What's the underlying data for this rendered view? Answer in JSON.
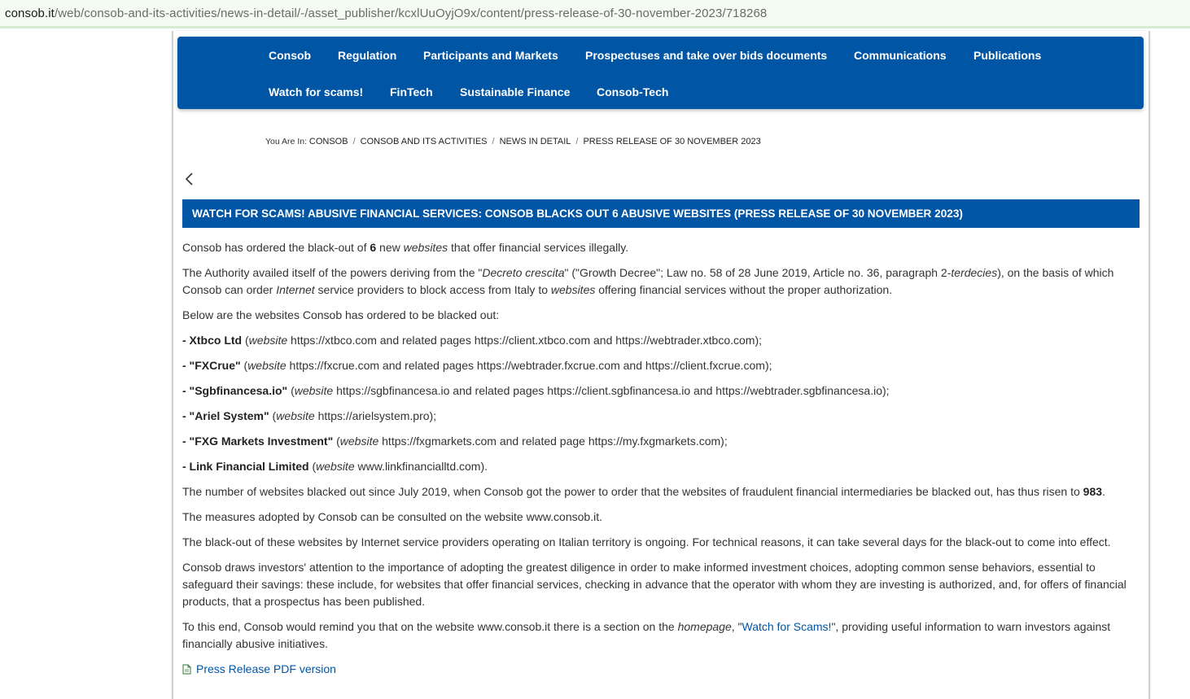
{
  "browser": {
    "url_host": "consob.it",
    "url_path": "/web/consob-and-its-activities/news-in-detail/-/asset_publisher/kcxlUuOyjO9x/content/press-release-of-30-november-2023/718268"
  },
  "nav": {
    "row1": [
      "Consob",
      "Regulation",
      "Participants and Markets",
      "Prospectuses and take over bids documents",
      "Communications",
      "Publications"
    ],
    "row2": [
      "Watch for scams!",
      "FinTech",
      "Sustainable Finance",
      "Consob-Tech"
    ]
  },
  "breadcrumb": {
    "prefix": "You Are In: ",
    "items": [
      "CONSOB",
      "CONSOB AND ITS ACTIVITIES",
      "NEWS IN DETAIL",
      "PRESS RELEASE OF 30 NOVEMBER 2023"
    ],
    "separator": "/"
  },
  "article": {
    "title": "WATCH FOR SCAMS! ABUSIVE FINANCIAL SERVICES: CONSOB BLACKS OUT 6 ABUSIVE WEBSITES (PRESS RELEASE OF 30 NOVEMBER 2023)",
    "p1": {
      "a": "Consob has ordered the black-out of ",
      "b": "6",
      "c": " new ",
      "d": "websites",
      "e": " that offer financial services illegally."
    },
    "p2": {
      "a": "The Authority availed itself of the powers deriving from the \"",
      "b": "Decreto crescita",
      "c": "\" (\"Growth Decree\"; Law no. 58 of 28 June 2019, Article no. 36, paragraph 2-",
      "d": "terdecies",
      "e": "), on the basis of which Consob can order ",
      "f": "Internet",
      "g": " service providers to block access from Italy to ",
      "h": "websites",
      "i": " offering financial services without the proper authorization."
    },
    "p3": "Below are the websites Consob has ordered to be blacked out:",
    "entries": [
      {
        "name": "- Xtbco Ltd",
        "open": " (",
        "web": "website",
        "rest": " https://xtbco.com and related pages https://client.xtbco.com and https://webtrader.xtbco.com);"
      },
      {
        "name": "- \"FXCrue\"",
        "open": " (",
        "web": "website",
        "rest": " https://fxcrue.com and related pages https://webtrader.fxcrue.com and https://client.fxcrue.com);"
      },
      {
        "name": "- \"Sgbfinancesa.io\"",
        "open": " (",
        "web": "website",
        "rest": " https://sgbfinancesa.io and related pages https://client.sgbfinancesa.io and https://webtrader.sgbfinancesa.io);"
      },
      {
        "name": "- \"Ariel System\"",
        "open": " (",
        "web": "website",
        "rest": " https://arielsystem.pro);"
      },
      {
        "name": "- \"FXG Markets Investment\"",
        "open": " (",
        "web": "website",
        "rest": " https://fxgmarkets.com and related page https://my.fxgmarkets.com);"
      },
      {
        "name": "- Link Financial Limited",
        "open": " (",
        "web": "website",
        "rest": " www.linkfinancialltd.com)."
      }
    ],
    "p4": {
      "a": "The number of websites blacked out since July 2019, when Consob got the power to order that the websites of fraudulent financial intermediaries be blacked out, has thus risen to ",
      "b": "983",
      "c": "."
    },
    "p5": "The measures adopted by Consob can be consulted on the website www.consob.it.",
    "p6": "The black-out of these websites by Internet service providers operating on Italian territory is ongoing. For technical reasons, it can take several days for the black-out to come into effect.",
    "p7": "Consob draws investors' attention to the importance of adopting the greatest diligence in order to make informed investment choices, adopting common sense behaviors, essential to safeguard their savings: these include, for websites that offer financial services, checking in advance that the operator with whom they are investing is authorized, and, for offers of financial products, that a prospectus has been published.",
    "p8": {
      "a": "To this end, Consob would remind you that on the website www.consob.it there is a section on the ",
      "b": "homepage",
      "c": ", \"",
      "link": "Watch for Scams!",
      "d": "\", providing useful information to warn investors against financially abusive initiatives."
    },
    "pdf_label": "Press Release PDF version"
  },
  "icons": {
    "back": "chevron-left-icon",
    "pdf": "pdf-file-icon"
  },
  "colors": {
    "brand_blue": "#0055a5",
    "urlbar_bg": "#f4fbf1"
  }
}
